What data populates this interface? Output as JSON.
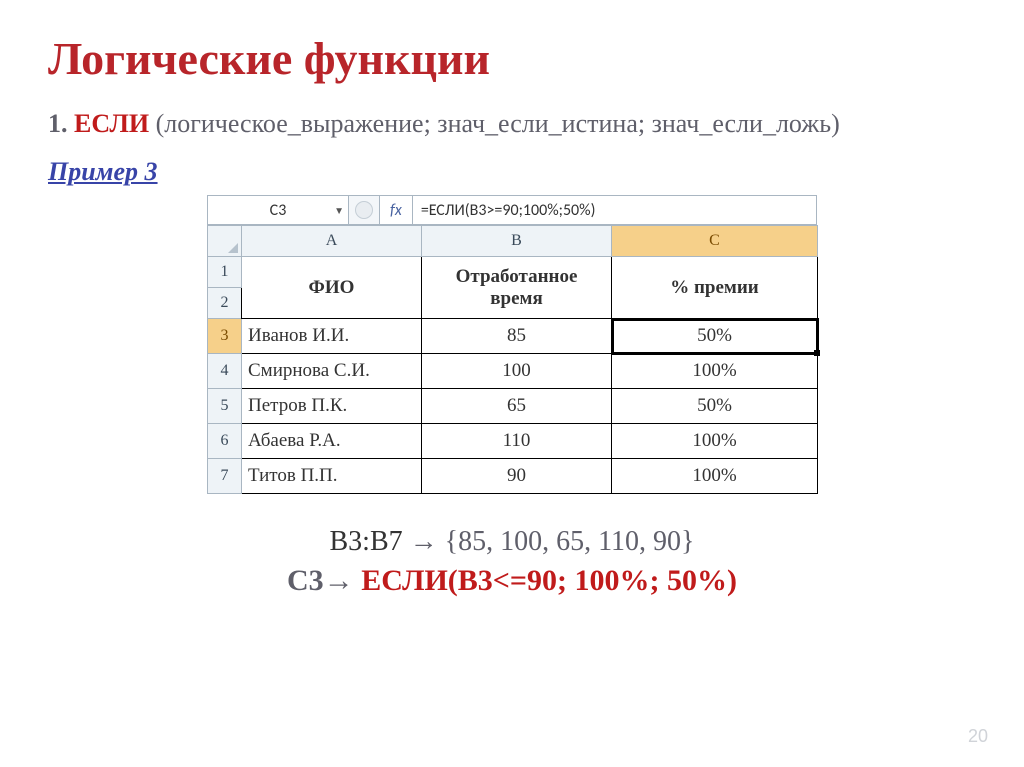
{
  "title": "Логические функции",
  "syntax": {
    "num": "1.",
    "func": "ЕСЛИ",
    "rest": " (логическое_выражение; знач_если_истина; знач_если_ложь)"
  },
  "example_label": "Пример 3",
  "formula_bar": {
    "name": "C3",
    "fx": "fx",
    "formula": "=ЕСЛИ(B3>=90;100%;50%)"
  },
  "columns": {
    "rowcorner": "",
    "A": "A",
    "B": "B",
    "C": "C"
  },
  "header_rows": {
    "r1": "1",
    "r2": "2"
  },
  "headers": {
    "A": "ФИО",
    "B": "Отработанное время",
    "C": "% премии"
  },
  "rows": [
    {
      "n": "3",
      "A": "Иванов И.И.",
      "B": "85",
      "C": "50%"
    },
    {
      "n": "4",
      "A": "Смирнова С.И.",
      "B": "100",
      "C": "100%"
    },
    {
      "n": "5",
      "A": "Петров П.К.",
      "B": "65",
      "C": "50%"
    },
    {
      "n": "6",
      "A": "Абаева Р.А.",
      "B": "110",
      "C": "100%"
    },
    {
      "n": "7",
      "A": "Титов П.П.",
      "B": "90",
      "C": "100%"
    }
  ],
  "range_line": {
    "lhs": "B3:B7 ",
    "arrow": "→",
    "rhs": " {85, 100, 65, 110, 90}"
  },
  "formula_line": {
    "lhs": "C3",
    "arrow": "→ ",
    "rhs": "ЕСЛИ(B3<=90; 100%; 50%)"
  },
  "page_number": "20"
}
